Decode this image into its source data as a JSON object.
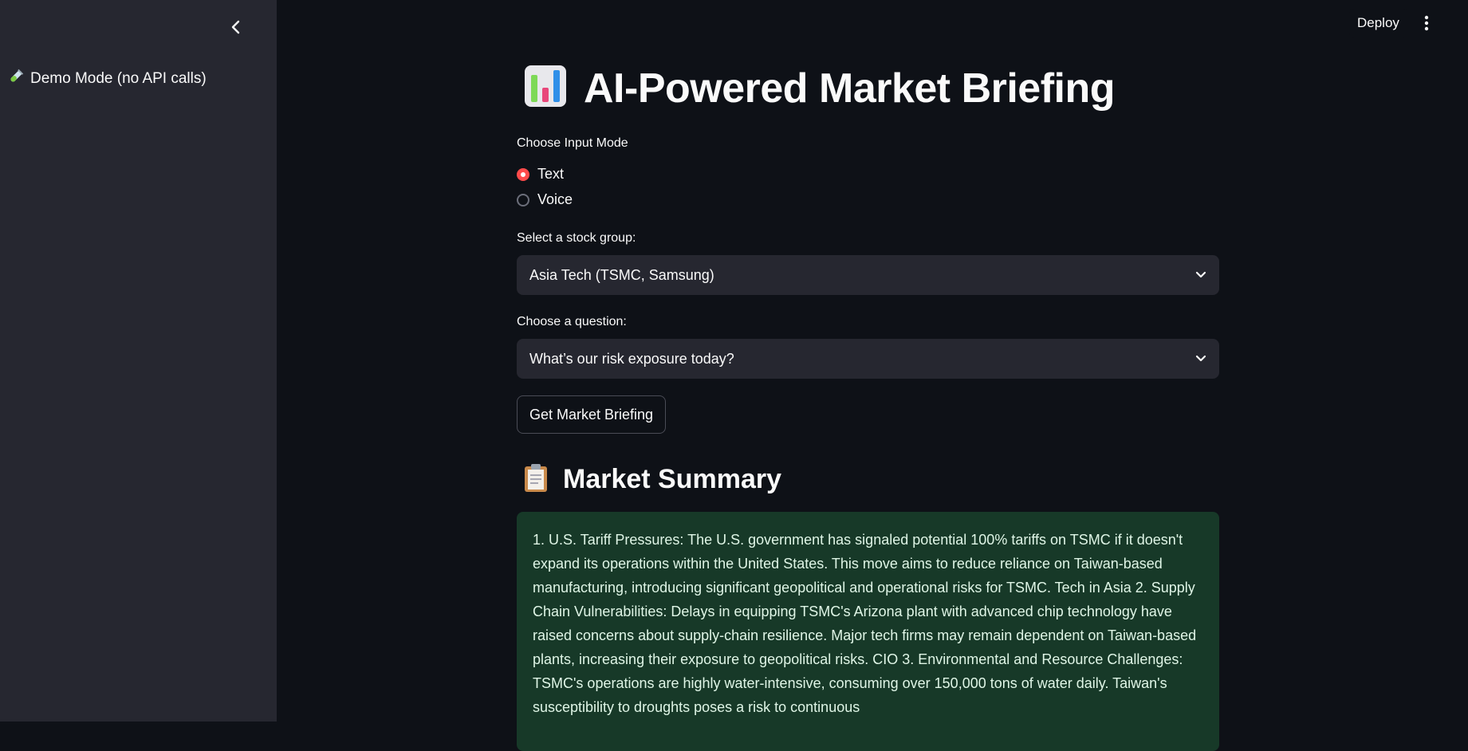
{
  "sidebar": {
    "items": [
      {
        "icon": "test-tube-icon",
        "label": "Demo Mode (no API calls)"
      }
    ]
  },
  "header": {
    "deploy_label": "Deploy"
  },
  "main": {
    "title": "AI-Powered Market Briefing",
    "input_mode": {
      "label": "Choose Input Mode",
      "options": [
        "Text",
        "Voice"
      ],
      "selected": "Text"
    },
    "stock_group": {
      "label": "Select a stock group:",
      "value": "Asia Tech (TSMC, Samsung)"
    },
    "question": {
      "label": "Choose a question:",
      "value": "What’s our risk exposure today?"
    },
    "action_button": "Get Market Briefing",
    "summary_heading": "Market Summary",
    "summary_text": "1. U.S. Tariff Pressures: The U.S. government has signaled potential 100% tariffs on TSMC if it doesn't expand its operations within the United States. This move aims to reduce reliance on Taiwan-based manufacturing, introducing significant geopolitical and operational risks for TSMC. Tech in Asia 2. Supply Chain Vulnerabilities: Delays in equipping TSMC's Arizona plant with advanced chip technology have raised concerns about supply-chain resilience. Major tech firms may remain dependent on Taiwan-based plants, increasing their exposure to geopolitical risks. CIO 3. Environmental and Resource Challenges: TSMC's operations are highly water-intensive, consuming over 150,000 tons of water daily. Taiwan's susceptibility to droughts poses a risk to continuous"
  },
  "colors": {
    "background": "#0e1117",
    "sidebar": "#262730",
    "accent": "#ff4b4b",
    "summary_bg": "#173928"
  }
}
